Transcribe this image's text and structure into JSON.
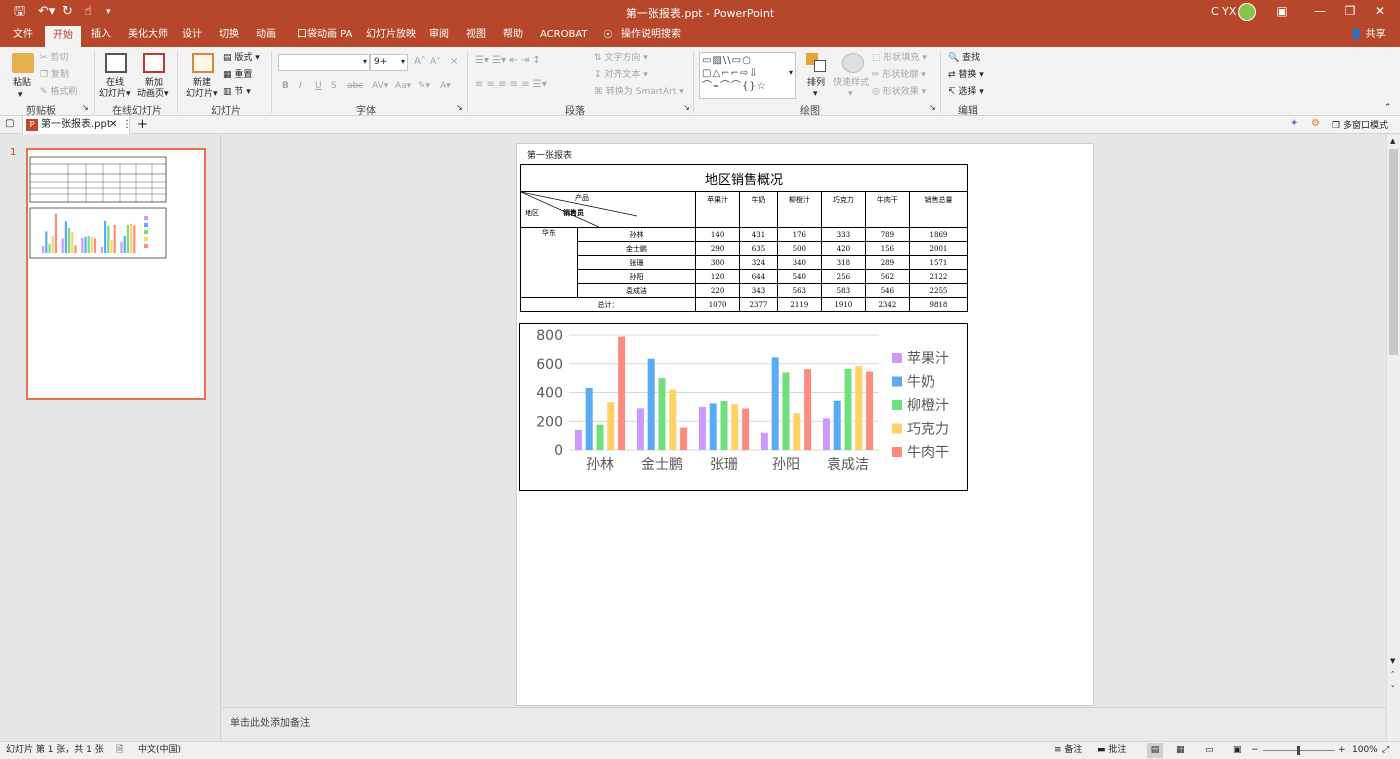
{
  "titlebar": {
    "doc_title": "第一张报表.ppt - PowerPoint",
    "user": "C YX",
    "save_icon": "save-icon",
    "undo_icon": "undo-icon",
    "redo_icon": "redo-icon",
    "touch_icon": "touch-mode-icon"
  },
  "tabs": [
    "文件",
    "开始",
    "插入",
    "美化大师",
    "设计",
    "切换",
    "动画",
    "口袋动画 PA",
    "幻灯片放映",
    "审阅",
    "视图",
    "帮助",
    "ACROBAT"
  ],
  "active_tab": "开始",
  "tell_me": "操作说明搜索",
  "share": "共享",
  "ribbon": {
    "clipboard": {
      "paste": "粘贴",
      "cut": "剪切",
      "copy": "复制",
      "format_painter": "格式刷",
      "label": "剪贴板"
    },
    "online_slides": {
      "online": "在线",
      "online2": "幻灯片",
      "new_anim": "新加",
      "new_anim2": "动画页",
      "label": "在线幻灯片"
    },
    "slides": {
      "new_slide": "新建",
      "new_slide2": "幻灯片",
      "layout": "版式",
      "reset": "重置",
      "section": "节",
      "label": "幻灯片"
    },
    "font": {
      "font_name": "",
      "font_size": "9+",
      "bold": "B",
      "italic": "I",
      "underline": "U",
      "shadow": "S",
      "strike": "abc",
      "label": "字体"
    },
    "paragraph": {
      "text_dir": "文字方向",
      "align_text": "对齐文本",
      "smartart": "转换为 SmartArt",
      "label": "段落"
    },
    "drawing": {
      "shapes": "▭▨\\\\▭○ ▢△⌐⌐⇨⇩ ⌒⌁⌒⌒{}☆",
      "arrange": "排列",
      "quick_styles": "快速样式",
      "fill": "形状填充",
      "outline": "形状轮廓",
      "effects": "形状效果",
      "label": "绘图"
    },
    "editing": {
      "find": "查找",
      "replace": "替换",
      "select": "选择",
      "label": "编辑"
    }
  },
  "doc_tab": {
    "name": "第一张报表.ppt",
    "multiwindow": "多窗口模式"
  },
  "thumb_number": "1",
  "slide": {
    "heading": "第一张报表",
    "table": {
      "title": "地区销售概况",
      "corner_product": "产品",
      "corner_sales": "销售员",
      "corner_region": "地区",
      "columns": [
        "苹果汁",
        "牛奶",
        "柳橙汁",
        "巧克力",
        "牛肉干",
        "销售总量"
      ],
      "region": "华东",
      "rows": [
        {
          "name": "孙林",
          "values": [
            "140",
            "431",
            "176",
            "333",
            "789",
            "1869"
          ]
        },
        {
          "name": "金士鹏",
          "values": [
            "290",
            "635",
            "500",
            "420",
            "156",
            "2001"
          ]
        },
        {
          "name": "张珊",
          "values": [
            "300",
            "324",
            "340",
            "318",
            "289",
            "1571"
          ]
        },
        {
          "name": "孙阳",
          "values": [
            "120",
            "644",
            "540",
            "256",
            "562",
            "2122"
          ]
        },
        {
          "name": "袁成洁",
          "values": [
            "220",
            "343",
            "563",
            "583",
            "546",
            "2255"
          ]
        }
      ],
      "total_label": "总计：",
      "totals": [
        "1070",
        "2377",
        "2119",
        "1910",
        "2342",
        "9818"
      ]
    }
  },
  "chart_data": {
    "type": "bar",
    "categories": [
      "孙林",
      "金士鹏",
      "张珊",
      "孙阳",
      "袁成洁"
    ],
    "series": [
      {
        "name": "苹果汁",
        "color": "#cc99ff",
        "values": [
          140,
          290,
          300,
          120,
          220
        ]
      },
      {
        "name": "牛奶",
        "color": "#5aaaf5",
        "values": [
          431,
          635,
          324,
          644,
          343
        ]
      },
      {
        "name": "柳橙汁",
        "color": "#6fe07c",
        "values": [
          176,
          500,
          340,
          540,
          563
        ]
      },
      {
        "name": "巧克力",
        "color": "#ffd166",
        "values": [
          333,
          420,
          318,
          256,
          583
        ]
      },
      {
        "name": "牛肉干",
        "color": "#ff8a80",
        "values": [
          789,
          156,
          289,
          562,
          546
        ]
      }
    ],
    "yticks": [
      "800",
      "600",
      "400",
      "200",
      "0"
    ],
    "ylim": [
      0,
      800
    ],
    "grid": true,
    "legend": "right"
  },
  "notes_placeholder": "单击此处添加备注",
  "status": {
    "slide_info": "幻灯片 第 1 张，共 1 张",
    "language": "中文(中国)",
    "notes": "备注",
    "comments": "批注",
    "zoom": "100%"
  }
}
